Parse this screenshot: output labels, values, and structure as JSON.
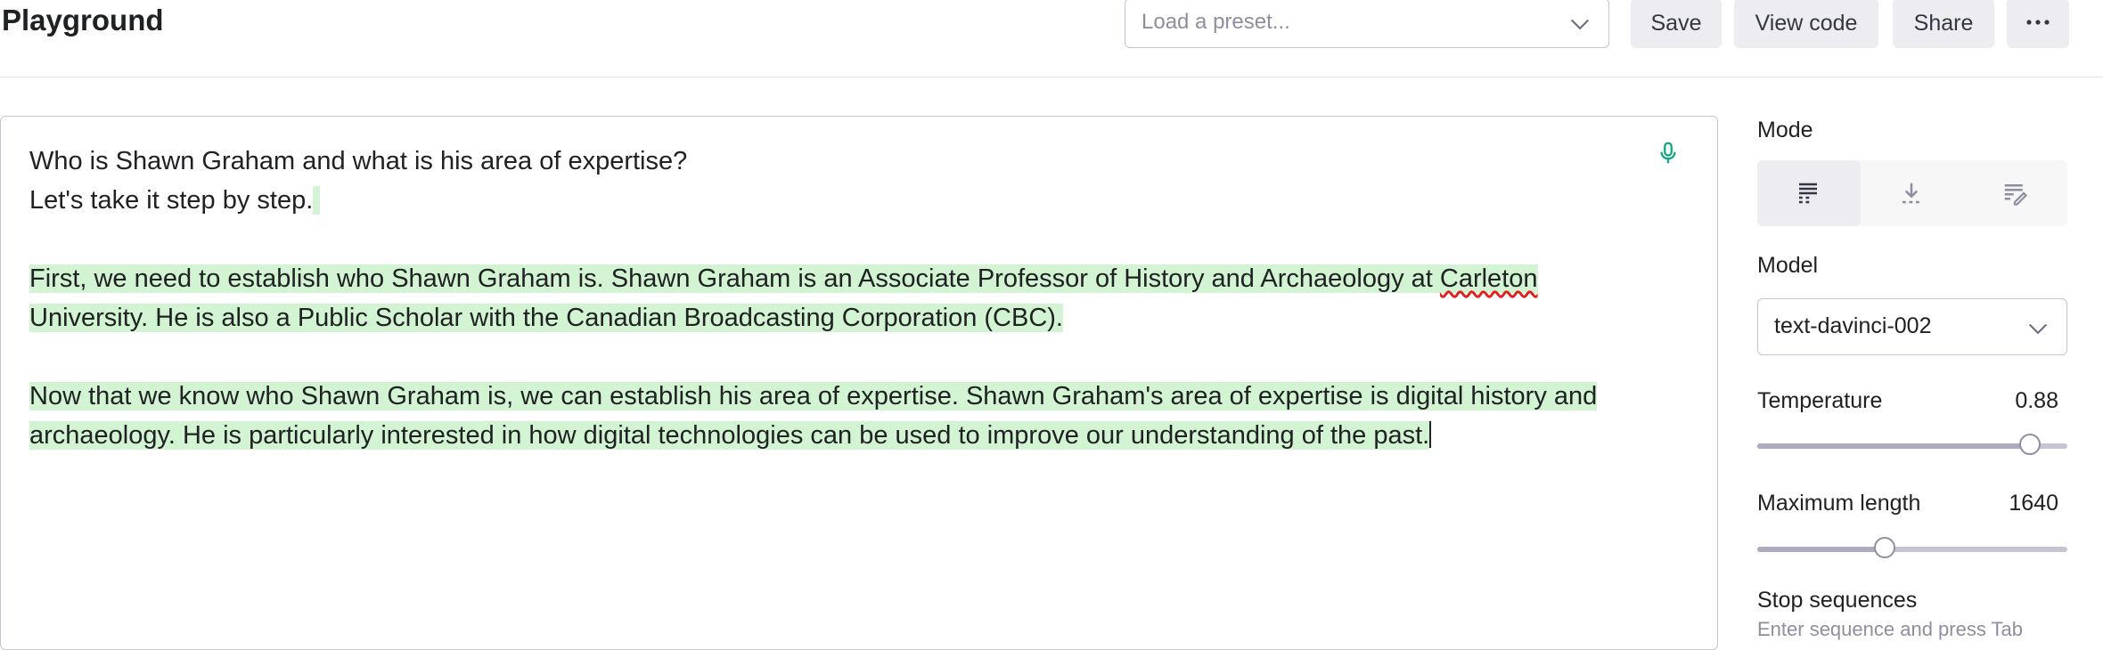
{
  "header": {
    "title": "Playground",
    "preset_placeholder": "Load a preset...",
    "save_label": "Save",
    "view_code_label": "View code",
    "share_label": "Share",
    "more_icon": "ellipsis-icon"
  },
  "editor": {
    "lines": [
      "Who is Shawn Graham and what is his area of expertise?",
      "Let's take it step by step.",
      "",
      "First, we need to establish who Shawn Graham is. Shawn Graham is an Associate Professor of History and Archaeology at ",
      "Carleton",
      "University. He is also a Public Scholar with the Canadian Broadcasting Corporation (CBC).",
      "Now that we know who Shawn Graham is, we can establish his area of expertise. Shawn Graham's area of expertise is digital history and",
      "archaeology. He is particularly interested in how digital technologies can be used to improve our understanding of the past."
    ],
    "mic_icon": "microphone-icon",
    "highlight_color": "#d2f4d3"
  },
  "settings": {
    "mode_label": "Mode",
    "mode_icons": [
      "complete-mode-icon",
      "insert-mode-icon",
      "edit-mode-icon"
    ],
    "model_label": "Model",
    "model_value": "text-davinci-002",
    "temperature_label": "Temperature",
    "temperature_value": "0.88",
    "temperature_fraction": 0.88,
    "max_length_label": "Maximum length",
    "max_length_value": "1640",
    "max_length_fraction": 0.41,
    "stop_label": "Stop sequences",
    "stop_placeholder": "Enter sequence and press Tab"
  }
}
